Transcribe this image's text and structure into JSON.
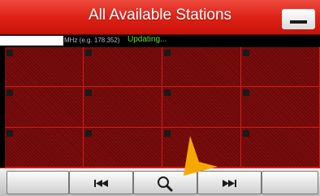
{
  "window": {
    "title": "All Available Stations",
    "minimize_icon": "minimize-icon"
  },
  "status_row": {
    "frequency_input_value": "",
    "frequency_hint": "MHz (e.g. 178.352)",
    "status_text": "Updating..."
  },
  "station_grid": {
    "columns": 4,
    "rows": 3,
    "cells": [
      "",
      "",
      "",
      "",
      "",
      "",
      "",
      "",
      "",
      "",
      "",
      ""
    ],
    "marker_icon": "square-marker-icon"
  },
  "toolbar": {
    "buttons": [
      {
        "name": "blank-left",
        "icon": ""
      },
      {
        "name": "previous",
        "icon": "skip-previous-icon"
      },
      {
        "name": "search",
        "icon": "search-icon"
      },
      {
        "name": "next",
        "icon": "skip-next-icon"
      },
      {
        "name": "blank-right",
        "icon": ""
      }
    ]
  },
  "pointer": {
    "icon": "pointer-arrow-icon"
  },
  "colors": {
    "title_bar": "#de2217",
    "grid_background": "#7e0c0c",
    "grid_lines": "#d21c1c",
    "status_text": "#66dd33",
    "pointer": "#f5a800"
  }
}
